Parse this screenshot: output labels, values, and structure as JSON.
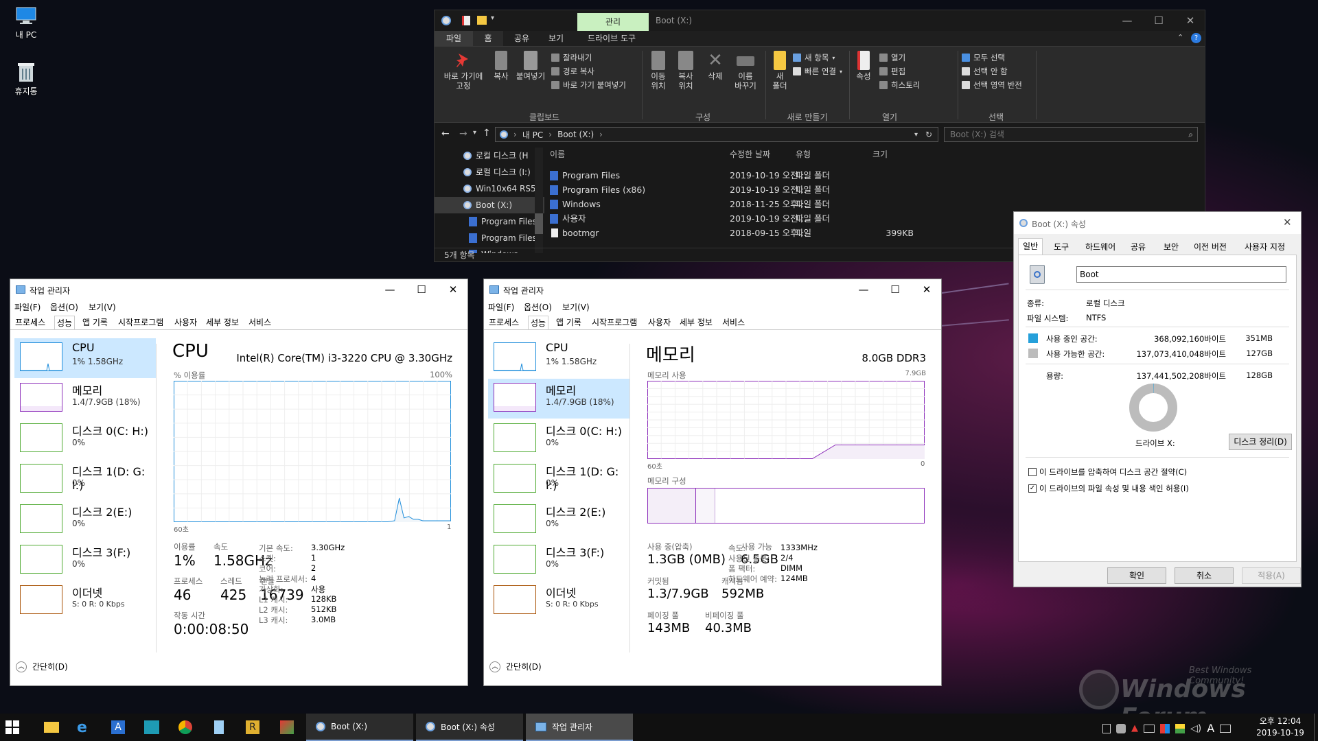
{
  "desktop": {
    "icons": [
      {
        "label": "내 PC",
        "icon": "computer-icon"
      },
      {
        "label": "휴지통",
        "icon": "recycle-bin-icon"
      }
    ],
    "watermark": {
      "tagline": "Best Windows Community!",
      "brand": "Windows Forum"
    }
  },
  "explorer": {
    "qat_context_tab": "관리",
    "title": "Boot (X:)",
    "tabs": [
      "파일",
      "홈",
      "공유",
      "보기",
      "드라이브 도구"
    ],
    "ribbon": {
      "pin": "바로 가기에\n고정",
      "copy": "복사",
      "paste": "붙여넣기",
      "cut": "잘라내기",
      "copy_path": "경로 복사",
      "paste_shortcut": "바로 가기 붙여넣기",
      "move_to": "이동\n위치",
      "copy_to": "복사\n위치",
      "delete": "삭제",
      "rename": "이름\n바꾸기",
      "new_folder": "새\n폴더",
      "new_item": "새 항목",
      "easy_access": "빠른 연결",
      "properties": "속성",
      "open": "열기",
      "edit": "편집",
      "history": "히스토리",
      "select_all": "모두 선택",
      "select_none": "선택 안 함",
      "invert_selection": "선택 영역 반전",
      "groups": [
        "클립보드",
        "구성",
        "새로 만들기",
        "열기",
        "선택"
      ]
    },
    "address": {
      "path": [
        "내 PC",
        "Boot (X:)"
      ],
      "search_placeholder": "Boot (X:) 검색"
    },
    "nav": [
      "로컬 디스크 (H",
      "로컬 디스크 (I:)",
      "Win10x64 RS5",
      "Boot (X:)",
      "Program Files",
      "Program Files",
      "Windows"
    ],
    "columns": [
      "이름",
      "수정한 날짜",
      "유형",
      "크기"
    ],
    "files": [
      {
        "name": "Program Files",
        "date": "2019-10-19 오전...",
        "type": "파일 폴더",
        "size": ""
      },
      {
        "name": "Program Files (x86)",
        "date": "2019-10-19 오전...",
        "type": "파일 폴더",
        "size": ""
      },
      {
        "name": "Windows",
        "date": "2018-11-25 오후...",
        "type": "파일 폴더",
        "size": ""
      },
      {
        "name": "사용자",
        "date": "2019-10-19 오전...",
        "type": "파일 폴더",
        "size": ""
      },
      {
        "name": "bootmgr",
        "date": "2018-09-15 오후...",
        "type": "파일",
        "size": "399KB"
      }
    ],
    "status": "5개 항목"
  },
  "tm1": {
    "title": "작업 관리자",
    "menu": [
      "파일(F)",
      "옵션(O)",
      "보기(V)"
    ],
    "tabs": [
      "프로세스",
      "성능",
      "앱 기록",
      "시작프로그램",
      "사용자",
      "세부 정보",
      "서비스"
    ],
    "side": [
      {
        "name": "CPU",
        "sub": "1%  1.58GHz"
      },
      {
        "name": "메모리",
        "sub": "1.4/7.9GB (18%)"
      },
      {
        "name": "디스크 0(C: H:)",
        "sub": "0%"
      },
      {
        "name": "디스크 1(D: G: I:)",
        "sub": "0%"
      },
      {
        "name": "디스크 2(E:)",
        "sub": "0%"
      },
      {
        "name": "디스크 3(F:)",
        "sub": "0%"
      },
      {
        "name": "이더넷",
        "sub": "S: 0  R: 0 Kbps"
      }
    ],
    "heading": "CPU",
    "model": "Intel(R) Core(TM) i3-3220 CPU @ 3.30GHz",
    "graph_label": "% 이용률",
    "graph_max": "100%",
    "graph_left": "60초",
    "graph_right": "1",
    "stats": {
      "util_l": "이용률",
      "util": "1%",
      "speed_l": "속도",
      "speed": "1.58GHz",
      "proc_l": "프로세스",
      "proc": "46",
      "thr_l": "스레드",
      "thr": "425",
      "hdl_l": "핸들",
      "hdl": "16739",
      "up_l": "작동 시간",
      "up": "0:00:08:50"
    },
    "details": [
      [
        "기본 속도:",
        "3.30GHz"
      ],
      [
        "소켓:",
        "1"
      ],
      [
        "코어:",
        "2"
      ],
      [
        "논리 프로세서:",
        "4"
      ],
      [
        "가상화:",
        "사용"
      ],
      [
        "L1 캐시:",
        "128KB"
      ],
      [
        "L2 캐시:",
        "512KB"
      ],
      [
        "L3 캐시:",
        "3.0MB"
      ]
    ],
    "fewer": "간단히(D)"
  },
  "tm2": {
    "title": "작업 관리자",
    "menu": [
      "파일(F)",
      "옵션(O)",
      "보기(V)"
    ],
    "tabs": [
      "프로세스",
      "성능",
      "앱 기록",
      "시작프로그램",
      "사용자",
      "세부 정보",
      "서비스"
    ],
    "heading": "메모리",
    "total": "8.0GB DDR3",
    "usage_label": "메모리 사용",
    "usage_max": "7.9GB",
    "graph_left": "60초",
    "graph_right": "0",
    "comp_label": "메모리 구성",
    "stats": {
      "inuse_l": "사용 중(압축)",
      "inuse": "1.3GB (0MB)",
      "avail_l": "사용 가능",
      "avail": "6.5GB",
      "commit_l": "커밋됨",
      "commit": "1.3/7.9GB",
      "cached_l": "캐시됨",
      "cached": "592MB",
      "paged_l": "페이징 풀",
      "paged": "143MB",
      "nonpaged_l": "비페이징 풀",
      "nonpaged": "40.3MB"
    },
    "details": [
      [
        "속도:",
        "1333MHz"
      ],
      [
        "사용된 슬롯:",
        "2/4"
      ],
      [
        "폼 팩터:",
        "DIMM"
      ],
      [
        "하드웨어 예약:",
        "124MB"
      ]
    ],
    "fewer": "간단히(D)"
  },
  "cpu_graph": {
    "x": [
      60,
      55,
      50,
      45,
      40,
      35,
      30,
      25,
      20,
      15,
      13,
      12,
      11,
      10,
      9,
      8,
      7,
      6,
      5,
      4,
      3,
      2,
      1
    ],
    "y": [
      0,
      0,
      0,
      0,
      0,
      0,
      0,
      0,
      0,
      0,
      1,
      17,
      3,
      4,
      2,
      2,
      1,
      1,
      1,
      1,
      1,
      1,
      1
    ]
  },
  "mem_graph": {
    "x": [
      60,
      40,
      25,
      20,
      15,
      10,
      5,
      1
    ],
    "y": [
      0,
      0,
      0,
      18,
      18,
      18,
      18,
      18
    ]
  },
  "props": {
    "title": "Boot (X:) 속성",
    "tabs": [
      "일반",
      "도구",
      "하드웨어",
      "공유",
      "보안",
      "이전 버전",
      "사용자 지정"
    ],
    "label": "Boot",
    "type_l": "종류:",
    "type": "로컬 디스크",
    "fs_l": "파일 시스템:",
    "fs": "NTFS",
    "used_l": "사용 중인 공간:",
    "used_b": "368,092,160바이트",
    "used": "351MB",
    "free_l": "사용 가능한 공간:",
    "free_b": "137,073,410,048바이트",
    "free": "127GB",
    "cap_l": "용량:",
    "cap_b": "137,441,502,208바이트",
    "cap": "128GB",
    "drive": "드라이브 X:",
    "cleanup": "디스크 정리(D)",
    "compress": "이 드라이브를 압축하여 디스크 공간 절약(C)",
    "index": "이 드라이브의 파일 속성 및 내용 색인 허용(I)",
    "ok": "확인",
    "cancel": "취소",
    "apply": "적용(A)",
    "used_color": "#26a0da",
    "free_color": "#bcbcbc"
  },
  "taskbar": {
    "items": [
      "Boot (X:)",
      "Boot (X:) 속성",
      "작업 관리자"
    ],
    "time": "오후 12:04",
    "date": "2019-10-19",
    "ime": "A"
  }
}
